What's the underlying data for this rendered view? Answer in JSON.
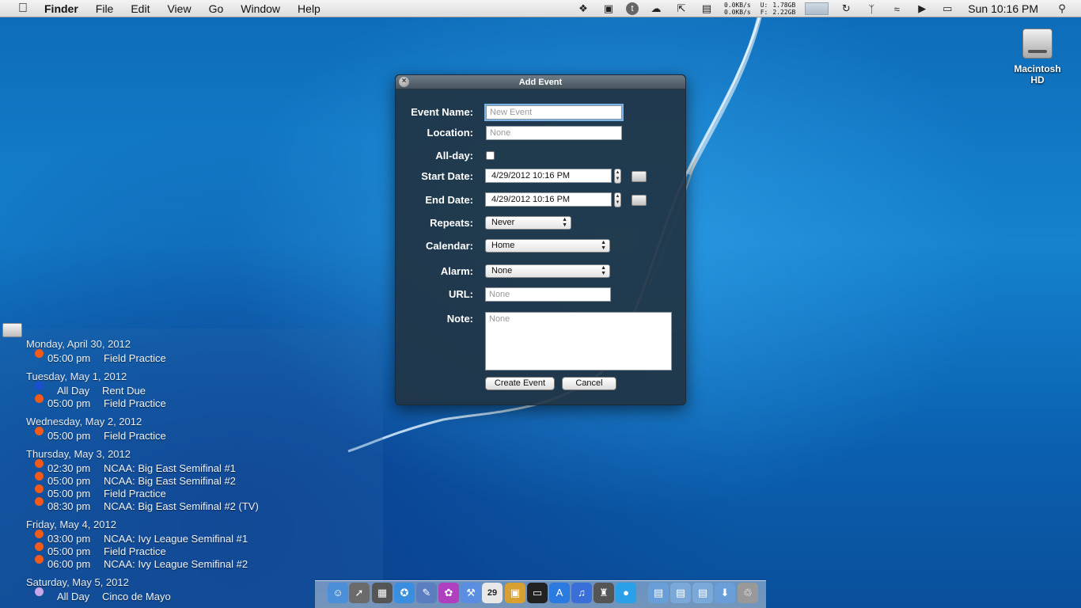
{
  "menubar": {
    "apple_icon": "apple-icon",
    "app_name": "Finder",
    "items": [
      "File",
      "Edit",
      "View",
      "Go",
      "Window",
      "Help"
    ],
    "net_up": "0.0KB/s",
    "net_down": "0.0KB/s",
    "disk_u_label": "U:",
    "disk_f_label": "F:",
    "disk_used": "1.78GB",
    "disk_free": "2.22GB",
    "clock": "Sun 10:16 PM"
  },
  "desktop": {
    "drive_label": "Macintosh HD"
  },
  "dialog": {
    "title": "Add Event",
    "labels": {
      "event_name": "Event Name:",
      "location": "Location:",
      "all_day": "All-day:",
      "start_date": "Start Date:",
      "end_date": "End Date:",
      "repeats": "Repeats:",
      "calendar": "Calendar:",
      "alarm": "Alarm:",
      "url": "URL:",
      "note": "Note:"
    },
    "event_name_placeholder": "New Event",
    "location_placeholder": "None",
    "start_date": "4/29/2012 10:16 PM",
    "end_date": "4/29/2012 10:16 PM",
    "repeats": "Never",
    "calendar": "Home",
    "alarm": "None",
    "url_placeholder": "None",
    "note_placeholder": "None",
    "create_button": "Create Event",
    "cancel_button": "Cancel"
  },
  "agenda": [
    {
      "day": "Monday, April 30, 2012",
      "events": [
        {
          "time": "05:00 pm",
          "title": "Field Practice",
          "color": "#f05a1a"
        }
      ]
    },
    {
      "day": "Tuesday, May 1, 2012",
      "events": [
        {
          "time": "All Day",
          "title": "Rent Due",
          "color": "#1a4fd0",
          "all_day": true
        },
        {
          "time": "05:00 pm",
          "title": "Field Practice",
          "color": "#f05a1a"
        }
      ]
    },
    {
      "day": "Wednesday, May 2, 2012",
      "events": [
        {
          "time": "05:00 pm",
          "title": "Field Practice",
          "color": "#f05a1a"
        }
      ]
    },
    {
      "day": "Thursday, May 3, 2012",
      "events": [
        {
          "time": "02:30 pm",
          "title": "NCAA: Big East Semifinal #1",
          "color": "#f05a1a"
        },
        {
          "time": "05:00 pm",
          "title": "NCAA: Big East Semifinal #2",
          "color": "#f05a1a"
        },
        {
          "time": "05:00 pm",
          "title": "Field Practice",
          "color": "#f05a1a"
        },
        {
          "time": "08:30 pm",
          "title": "NCAA: Big East Semifinal #2 (TV)",
          "color": "#f05a1a"
        }
      ]
    },
    {
      "day": "Friday, May 4, 2012",
      "events": [
        {
          "time": "03:00 pm",
          "title": "NCAA: Ivy League Semifinal #1",
          "color": "#f05a1a"
        },
        {
          "time": "05:00 pm",
          "title": "Field Practice",
          "color": "#f05a1a"
        },
        {
          "time": "06:00 pm",
          "title": "NCAA: Ivy League Semifinal #2",
          "color": "#f05a1a"
        }
      ]
    },
    {
      "day": "Saturday, May 5, 2012",
      "events": [
        {
          "time": "All Day",
          "title": "Cinco de Mayo",
          "color": "#c9a6e8",
          "all_day": true
        }
      ]
    }
  ],
  "dock": {
    "icons": [
      "finder-icon",
      "launchpad-icon",
      "dashboard-icon",
      "safari-icon",
      "preview-icon",
      "photo-icon",
      "xcode-icon",
      "ical-icon",
      "package-icon",
      "terminal-icon",
      "app-store-icon",
      "itunes-icon",
      "lantern-icon",
      "messages-icon",
      "applications-folder-icon",
      "network-folder-icon",
      "utilities-folder-icon",
      "downloads-icon",
      "trash-icon"
    ],
    "ical_day": "29"
  }
}
